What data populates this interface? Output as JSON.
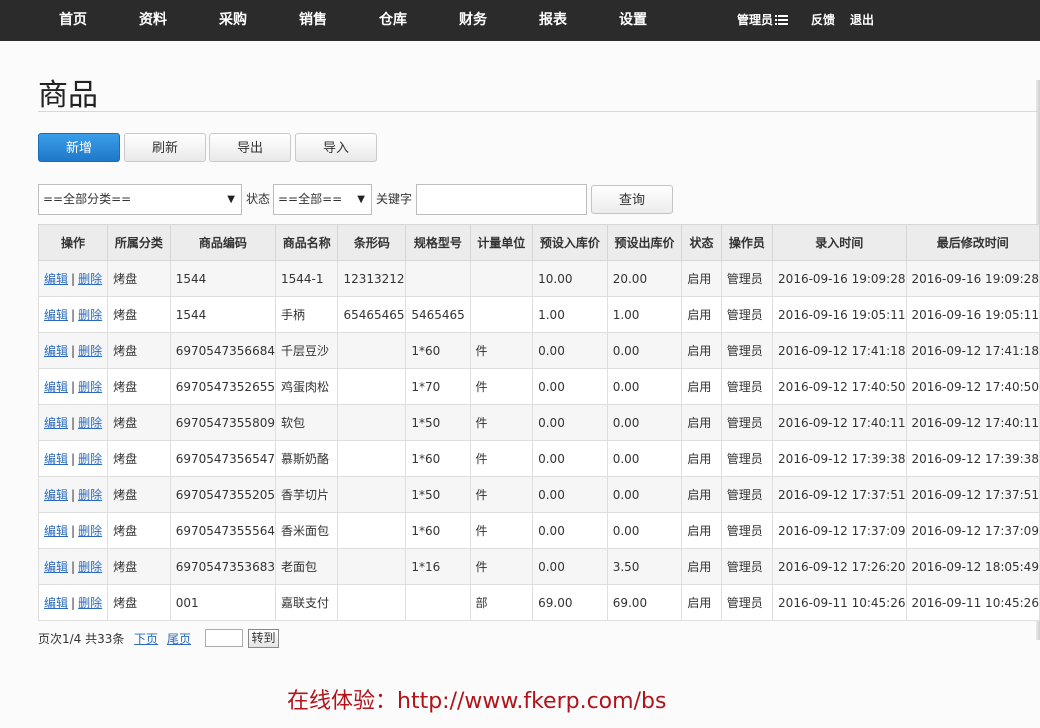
{
  "nav": {
    "items": [
      "首页",
      "资料",
      "采购",
      "销售",
      "仓库",
      "财务",
      "报表",
      "设置"
    ],
    "admin_label": "管理员",
    "feedback": "反馈",
    "logout": "退出"
  },
  "page": {
    "title": "商品"
  },
  "toolbar": {
    "add": "新增",
    "refresh": "刷新",
    "export": "导出",
    "import": "导入"
  },
  "filters": {
    "category": "==全部分类==",
    "status_label": "状态",
    "status": "==全部==",
    "keyword_label": "关键字",
    "keyword_value": "",
    "query": "查询"
  },
  "table": {
    "columns": [
      "操作",
      "所属分类",
      "商品编码",
      "商品名称",
      "条形码",
      "规格型号",
      "计量单位",
      "预设入库价",
      "预设出库价",
      "状态",
      "操作员",
      "录入时间",
      "最后修改时间"
    ],
    "edit_label": "编辑",
    "delete_label": "删除",
    "rows": [
      [
        "烤盘",
        "1544",
        "1544-1",
        "12313212",
        "",
        "",
        "10.00",
        "20.00",
        "启用",
        "管理员",
        "2016-09-16 19:09:28",
        "2016-09-16 19:09:28"
      ],
      [
        "烤盘",
        "1544",
        "手柄",
        "65465465",
        "5465465",
        "",
        "1.00",
        "1.00",
        "启用",
        "管理员",
        "2016-09-16 19:05:11",
        "2016-09-16 19:05:11"
      ],
      [
        "烤盘",
        "6970547356684",
        "千层豆沙",
        "",
        "1*60",
        "件",
        "0.00",
        "0.00",
        "启用",
        "管理员",
        "2016-09-12 17:41:18",
        "2016-09-12 17:41:18"
      ],
      [
        "烤盘",
        "6970547352655",
        "鸡蛋肉松",
        "",
        "1*70",
        "件",
        "0.00",
        "0.00",
        "启用",
        "管理员",
        "2016-09-12 17:40:50",
        "2016-09-12 17:40:50"
      ],
      [
        "烤盘",
        "6970547355809",
        "软包",
        "",
        "1*50",
        "件",
        "0.00",
        "0.00",
        "启用",
        "管理员",
        "2016-09-12 17:40:11",
        "2016-09-12 17:40:11"
      ],
      [
        "烤盘",
        "6970547356547",
        "慕斯奶酪",
        "",
        "1*60",
        "件",
        "0.00",
        "0.00",
        "启用",
        "管理员",
        "2016-09-12 17:39:38",
        "2016-09-12 17:39:38"
      ],
      [
        "烤盘",
        "6970547355205",
        "香芋切片",
        "",
        "1*50",
        "件",
        "0.00",
        "0.00",
        "启用",
        "管理员",
        "2016-09-12 17:37:51",
        "2016-09-12 17:37:51"
      ],
      [
        "烤盘",
        "6970547355564",
        "香米面包",
        "",
        "1*60",
        "件",
        "0.00",
        "0.00",
        "启用",
        "管理员",
        "2016-09-12 17:37:09",
        "2016-09-12 17:37:09"
      ],
      [
        "烤盘",
        "6970547353683",
        "老面包",
        "",
        "1*16",
        "件",
        "0.00",
        "3.50",
        "启用",
        "管理员",
        "2016-09-12 17:26:20",
        "2016-09-12 18:05:49"
      ],
      [
        "烤盘",
        "001",
        "嘉联支付",
        "",
        "",
        "部",
        "69.00",
        "69.00",
        "启用",
        "管理员",
        "2016-09-11 10:45:26",
        "2016-09-11 10:45:26"
      ]
    ]
  },
  "pager": {
    "info": "页次1/4 共33条",
    "next": "下页",
    "last": "尾页",
    "page_input": "",
    "goto": "转到"
  },
  "promo": "在线体验：http://www.fkerp.com/bs"
}
